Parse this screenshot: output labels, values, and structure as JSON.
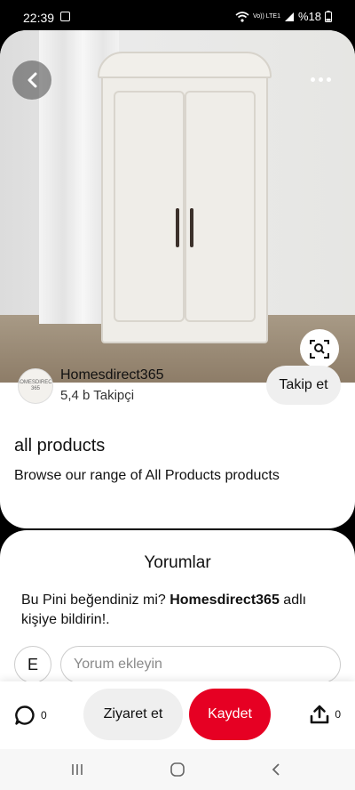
{
  "status_bar": {
    "time": "22:39",
    "network_small": "Vo)) LTE1",
    "battery": "%18"
  },
  "creator": {
    "avatar_text": "HOMESDIRECT 365",
    "name": "Homesdirect365",
    "followers": "5,4 b Takipçi",
    "follow_label": "Takip et"
  },
  "pin": {
    "title": "all products",
    "description": "Browse our range of All Products products"
  },
  "comments": {
    "heading": "Yorumlar",
    "prompt_start": "Bu Pini beğendiniz mi?",
    "prompt_name": "Homesdirect365",
    "prompt_end": "adlı kişiye bildirin!.",
    "user_initial": "E",
    "input_placeholder": "Yorum ekleyin"
  },
  "action_bar": {
    "comment_count": "0",
    "visit_label": "Ziyaret et",
    "save_label": "Kaydet",
    "share_count": "0"
  },
  "colors": {
    "save_red": "#e60023",
    "chip_gray": "#efefef"
  }
}
